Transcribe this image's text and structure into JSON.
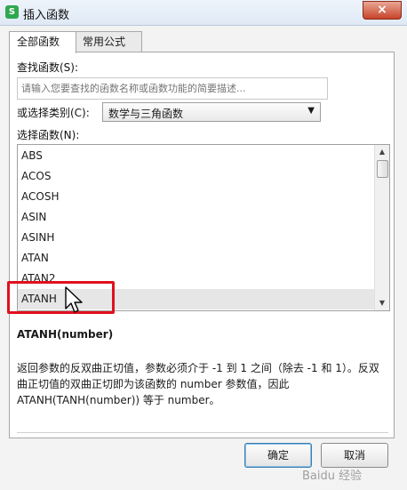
{
  "window": {
    "title": "插入函数",
    "app_icon": "S",
    "close": "×"
  },
  "tabs": [
    {
      "label": "全部函数",
      "active": true
    },
    {
      "label": "常用公式",
      "active": false
    }
  ],
  "search": {
    "label": "查找函数(S):",
    "placeholder": "请输入您要查找的函数名称或函数功能的简要描述..."
  },
  "category": {
    "label": "或选择类别(C):",
    "value": "数学与三角函数",
    "arrow": "▼"
  },
  "function_list": {
    "label": "选择函数(N):",
    "items": [
      "ABS",
      "ACOS",
      "ACOSH",
      "ASIN",
      "ASINH",
      "ATAN",
      "ATAN2",
      "ATANH"
    ],
    "selected": "ATANH",
    "scroll_up": "▲",
    "scroll_down": "▼"
  },
  "details": {
    "signature": "ATANH(number)",
    "description": "返回参数的反双曲正切值，参数必须介于 -1 到 1 之间（除去 -1 和 1）。反双曲正切值的双曲正切即为该函数的 number 参数值，因此 ATANH(TANH(number)) 等于 number。"
  },
  "buttons": {
    "ok": "确定",
    "cancel": "取消"
  },
  "watermark": "Baidu 经验"
}
